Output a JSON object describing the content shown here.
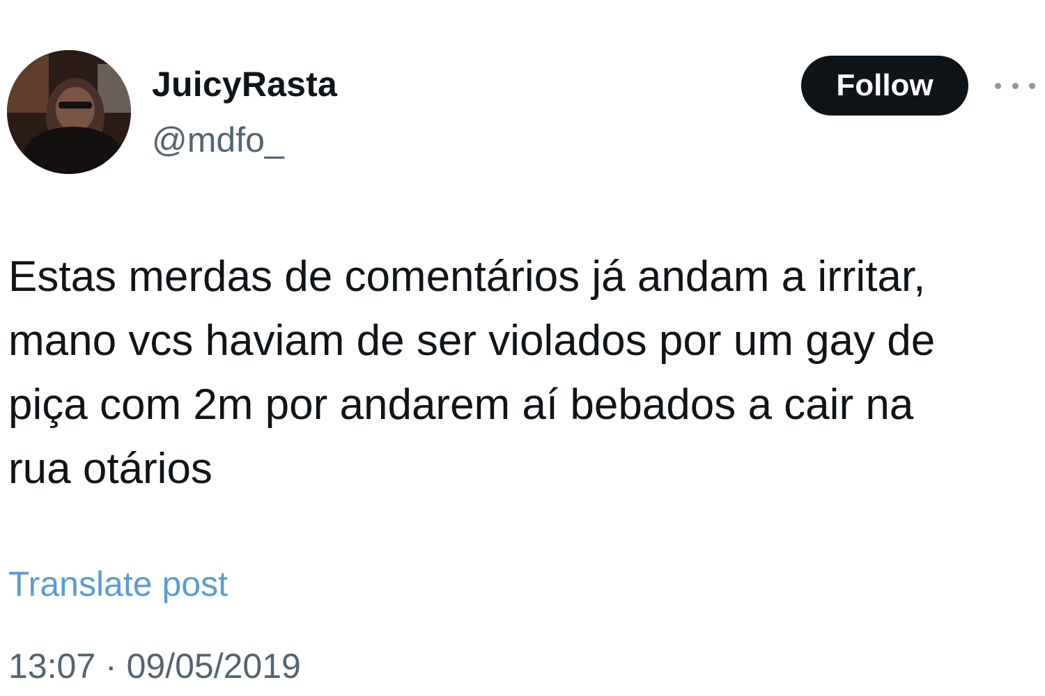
{
  "author": {
    "display_name": "JuicyRasta",
    "handle": "@mdfo_",
    "avatar_icon": "user-avatar-photo"
  },
  "actions": {
    "follow_label": "Follow",
    "more_icon": "more-horizontal-icon"
  },
  "post": {
    "text": "Estas merdas de comentários já andam a irritar,\nmano vcs haviam de ser violados por um gay de\npiça com 2m por andarem aí bebados a cair na\nrua otários",
    "translate_label": "Translate post",
    "time": "13:07",
    "separator": "·",
    "date": "09/05/2019"
  },
  "colors": {
    "follow_bg": "#0f1419",
    "translate_link": "#5b9bd5",
    "secondary_text": "#536471"
  }
}
